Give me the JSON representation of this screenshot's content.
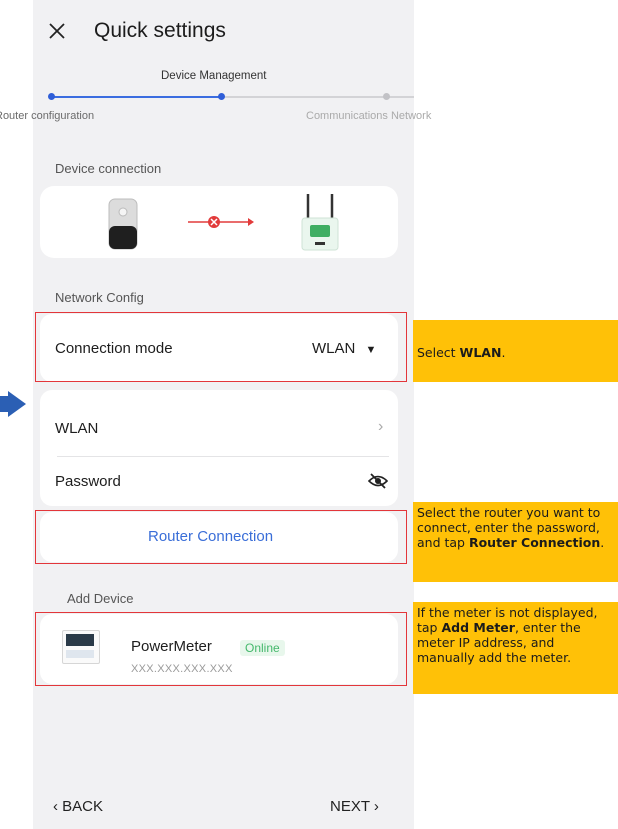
{
  "header": {
    "title": "Quick settings"
  },
  "stepper": {
    "current_step": "Device Management",
    "previous_step": "Router configuration",
    "next_step": "Communications Network"
  },
  "device_connection": {
    "section_label": "Device connection",
    "status": "not connected"
  },
  "network_config": {
    "section_label": "Network Config",
    "connection_mode_label": "Connection mode",
    "connection_mode_value": "WLAN",
    "wlan_label": "WLAN",
    "password_label": "Password",
    "router_connection_label": "Router Connection"
  },
  "add_device": {
    "section_label": "Add Device",
    "device_name": "PowerMeter",
    "device_status": "Online",
    "device_ip": "XXX.XXX.XXX.XXX"
  },
  "footer": {
    "back_label": "BACK",
    "next_label": "NEXT"
  },
  "callouts": {
    "c1_pre": "Select ",
    "c1_bold": "WLAN",
    "c1_post": ".",
    "c2_pre": "Select the router you want to connect, enter the password, and tap ",
    "c2_bold": "Router Connection",
    "c2_post": ".",
    "c3_pre": "If the meter is not displayed, tap ",
    "c3_bold": "Add Meter",
    "c3_post": ", enter the meter IP address, and manually add the meter."
  },
  "colors": {
    "accent": "#3a6ed8",
    "highlight": "#e3363a",
    "callout": "#ffc107",
    "online": "#44b86b"
  }
}
